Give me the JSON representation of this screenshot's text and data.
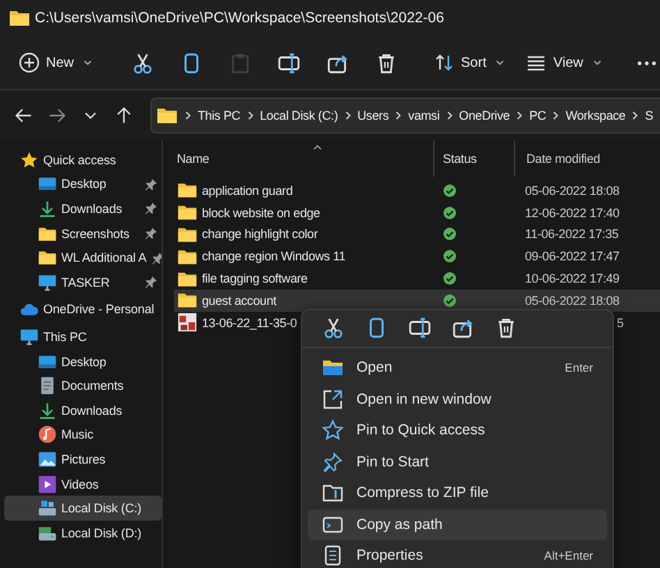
{
  "window": {
    "title": "C:\\Users\\vamsi\\OneDrive\\PC\\Workspace\\Screenshots\\2022-06"
  },
  "toolbar": [
    {
      "kind": "new",
      "label": "New"
    },
    {
      "kind": "sep"
    },
    {
      "kind": "cut",
      "disabled": false
    },
    {
      "kind": "copy",
      "disabled": false
    },
    {
      "kind": "paste",
      "disabled": true
    },
    {
      "kind": "rename",
      "disabled": false
    },
    {
      "kind": "share",
      "disabled": false
    },
    {
      "kind": "delete",
      "disabled": false
    },
    {
      "kind": "sep"
    },
    {
      "kind": "sort",
      "label": "Sort"
    },
    {
      "kind": "view",
      "label": "View"
    },
    {
      "kind": "sep"
    },
    {
      "kind": "more"
    }
  ],
  "address": {
    "crumbs": [
      "This PC",
      "Local Disk (C:)",
      "Users",
      "vamsi",
      "OneDrive",
      "PC",
      "Workspace",
      "S"
    ]
  },
  "sidebar": {
    "items": [
      {
        "label": "Quick access",
        "kind": "star",
        "selected": false,
        "children": [
          {
            "label": "Desktop",
            "kind": "desktop",
            "pinned": true,
            "selected": false
          },
          {
            "label": "Downloads",
            "kind": "download",
            "pinned": true,
            "selected": false
          },
          {
            "label": "Screenshots",
            "kind": "folder",
            "pinned": true,
            "selected": false
          },
          {
            "label": "WL Additional A",
            "kind": "folder",
            "pinned": true,
            "selected": false
          },
          {
            "label": "TASKER",
            "kind": "monitor",
            "pinned": true,
            "selected": false
          }
        ]
      },
      {
        "label": "OneDrive - Personal",
        "kind": "cloud",
        "selected": false
      },
      {
        "label": "This PC",
        "kind": "monitor",
        "selected": false,
        "children": [
          {
            "label": "Desktop",
            "kind": "desktop",
            "selected": false
          },
          {
            "label": "Documents",
            "kind": "document",
            "selected": false
          },
          {
            "label": "Downloads",
            "kind": "download",
            "selected": false
          },
          {
            "label": "Music",
            "kind": "music",
            "selected": false
          },
          {
            "label": "Pictures",
            "kind": "picture",
            "selected": false
          },
          {
            "label": "Videos",
            "kind": "video",
            "selected": false
          },
          {
            "label": "Local Disk (C:)",
            "kind": "drive",
            "selected": true
          },
          {
            "label": "Local Disk (D:)",
            "kind": "drive2",
            "selected": false
          }
        ]
      }
    ]
  },
  "table": {
    "columns": [
      "Name",
      "Status",
      "Date modified"
    ],
    "rows": [
      {
        "name": "application guard",
        "kind": "folder",
        "synced": true,
        "date": "05-06-2022 18:08",
        "selected": false
      },
      {
        "name": "block website on edge",
        "kind": "folder",
        "synced": true,
        "date": "12-06-2022 17:40",
        "selected": false
      },
      {
        "name": "change highlight color",
        "kind": "folder",
        "synced": true,
        "date": "11-06-2022 17:35",
        "selected": false
      },
      {
        "name": "change region Windows 11",
        "kind": "folder",
        "synced": true,
        "date": "09-06-2022 17:47",
        "selected": false
      },
      {
        "name": "file tagging software",
        "kind": "folder",
        "synced": true,
        "date": "10-06-2022 17:49",
        "selected": false
      },
      {
        "name": "guest account",
        "kind": "folder",
        "synced": true,
        "date": "05-06-2022 18:08",
        "selected": true
      },
      {
        "name": "13-06-22_11-35-0",
        "kind": "image",
        "date": "5",
        "selected": false
      }
    ]
  },
  "context_menu": {
    "items": [
      {
        "label": "Open",
        "kind": "open",
        "shortcut": "Enter",
        "selected": false
      },
      {
        "label": "Open in new window",
        "kind": "newwindow",
        "selected": false
      },
      {
        "label": "Pin to Quick access",
        "kind": "star",
        "selected": false
      },
      {
        "label": "Pin to Start",
        "kind": "pin",
        "selected": false
      },
      {
        "label": "Compress to ZIP file",
        "kind": "zip",
        "selected": false
      },
      {
        "label": "Copy as path",
        "kind": "path",
        "selected": true
      },
      {
        "label": "Properties",
        "kind": "properties",
        "shortcut": "Alt+Enter",
        "selected": false
      }
    ]
  }
}
